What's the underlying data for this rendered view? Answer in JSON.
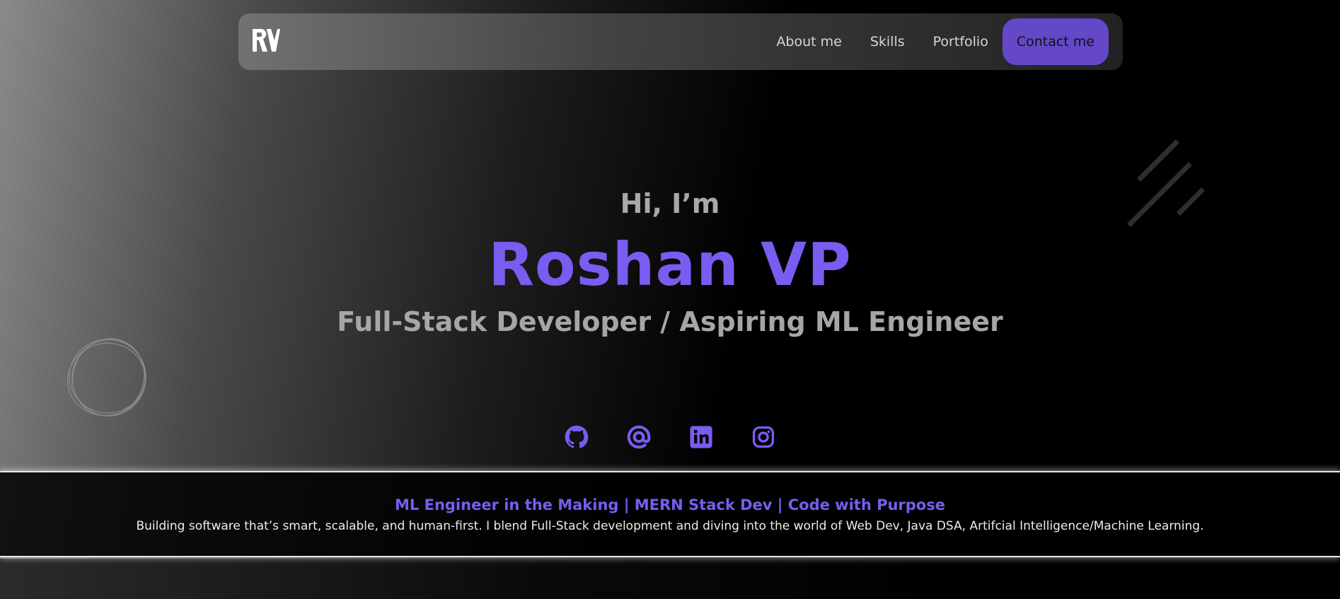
{
  "colors": {
    "accent": "#7a5cf0",
    "button": "#6448c8",
    "muted_text": "#a9a9a9"
  },
  "nav": {
    "logo_icon": "rv-logo-icon",
    "links": [
      "About me",
      "Skills",
      "Portfolio"
    ],
    "contact_label": "Contact me"
  },
  "hero": {
    "greeting": "Hi, I’m",
    "name": "Roshan VP",
    "role": "Full-Stack Developer / Aspiring ML Engineer"
  },
  "socials": [
    {
      "icon": "github-icon"
    },
    {
      "icon": "at-email-icon"
    },
    {
      "icon": "linkedin-icon"
    },
    {
      "icon": "instagram-icon"
    }
  ],
  "band": {
    "title": "ML Engineer in the Making | MERN Stack Dev | Code with Purpose",
    "text": "Building software that’s smart, scalable, and human-first. I blend Full-Stack development and diving into the world of Web Dev, Java DSA, Artifcial Intelligence/Machine Learning."
  }
}
